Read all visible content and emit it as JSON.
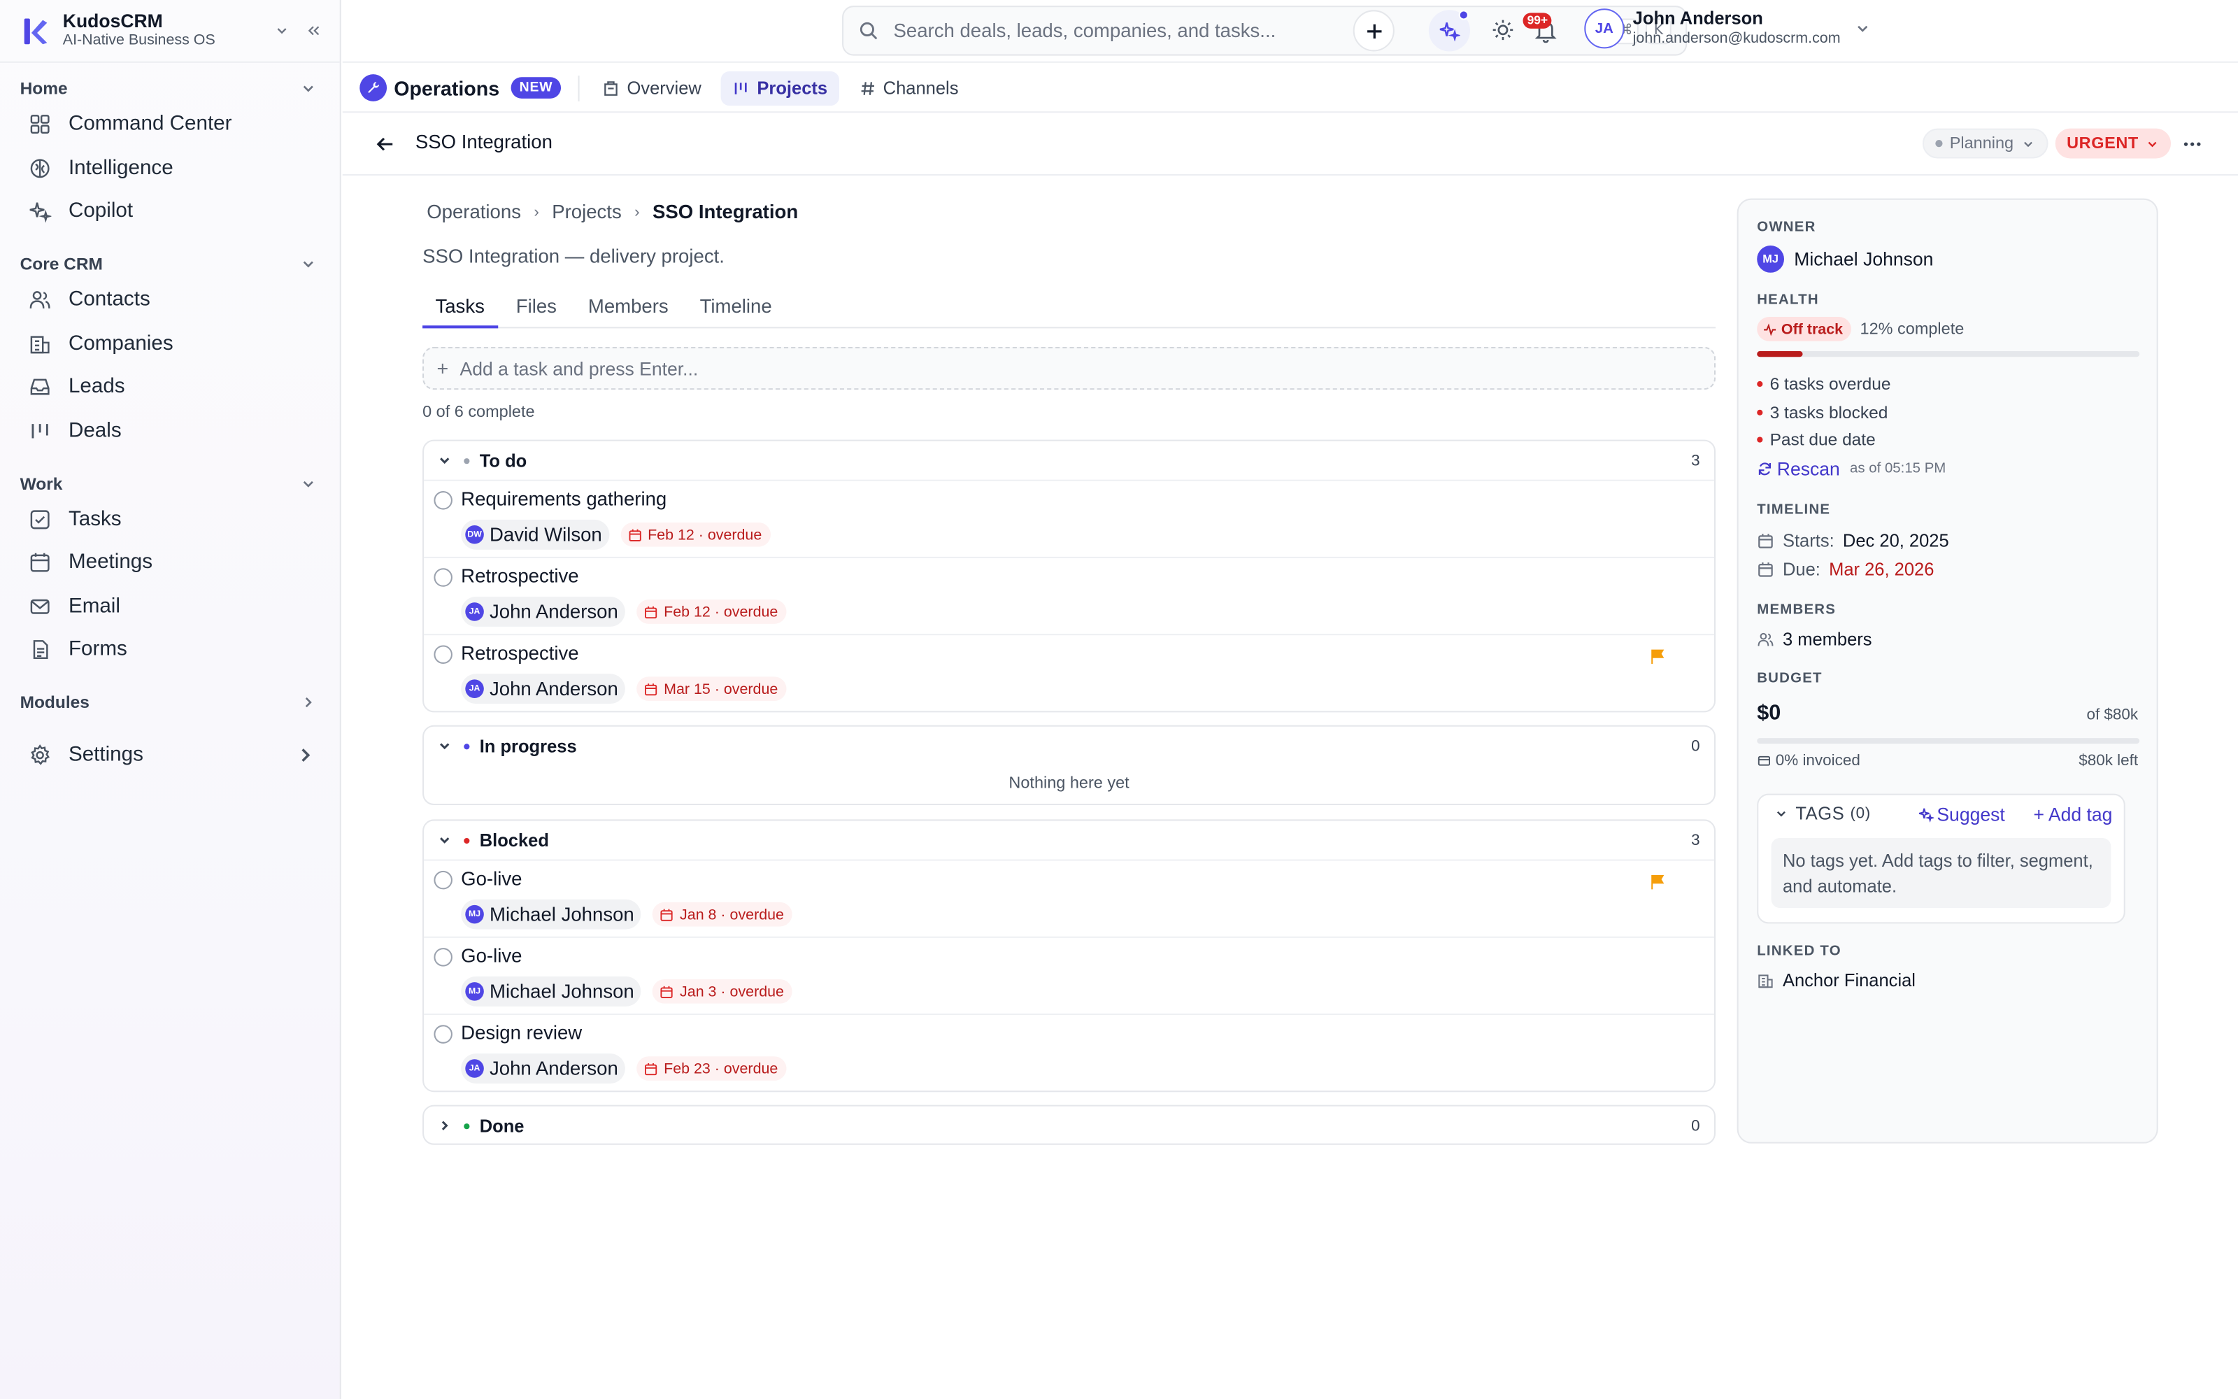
{
  "brand": {
    "name": "KudosCRM",
    "tagline": "AI-Native Business OS"
  },
  "sidebar": {
    "sections": [
      {
        "title": "Home",
        "items": [
          {
            "label": "Command Center",
            "icon": "grid-icon"
          },
          {
            "label": "Intelligence",
            "icon": "brain-icon"
          },
          {
            "label": "Copilot",
            "icon": "sparkle-icon"
          }
        ]
      },
      {
        "title": "Core CRM",
        "items": [
          {
            "label": "Contacts",
            "icon": "users-icon"
          },
          {
            "label": "Companies",
            "icon": "building-icon"
          },
          {
            "label": "Leads",
            "icon": "inbox-icon"
          },
          {
            "label": "Deals",
            "icon": "kanban-icon"
          }
        ]
      },
      {
        "title": "Work",
        "items": [
          {
            "label": "Tasks",
            "icon": "checkbox-icon"
          },
          {
            "label": "Meetings",
            "icon": "calendar-icon"
          },
          {
            "label": "Email",
            "icon": "mail-icon"
          },
          {
            "label": "Forms",
            "icon": "form-icon"
          }
        ]
      }
    ],
    "modules_label": "Modules",
    "settings_label": "Settings"
  },
  "topbar": {
    "search_placeholder": "Search deals, leads, companies, and tasks...",
    "kbd_mod": "⌘",
    "kbd_key": "K",
    "notif_count": "99+",
    "user": {
      "initials": "JA",
      "name": "John Anderson",
      "email": "john.anderson@kudoscrm.com"
    }
  },
  "module": {
    "title": "Operations",
    "badge": "NEW",
    "tabs": [
      {
        "label": "Overview",
        "active": false
      },
      {
        "label": "Projects",
        "active": true
      },
      {
        "label": "Channels",
        "active": false
      }
    ]
  },
  "page": {
    "title": "SSO Integration",
    "status": "Planning",
    "priority": "URGENT",
    "breadcrumb": [
      "Operations",
      "Projects",
      "SSO Integration"
    ],
    "description": "SSO Integration — delivery project.",
    "tabs": [
      "Tasks",
      "Files",
      "Members",
      "Timeline"
    ],
    "add_task_placeholder": "Add a task and press Enter...",
    "progress_text": "0 of 6 complete"
  },
  "groups": [
    {
      "name": "To do",
      "count": "3",
      "color": "#9ca3af",
      "expanded": true,
      "tasks": [
        {
          "title": "Requirements gathering",
          "assignee": "David Wilson",
          "initials": "DW",
          "due": "Feb 12 · overdue",
          "flag": false
        },
        {
          "title": "Retrospective",
          "assignee": "John Anderson",
          "initials": "JA",
          "due": "Feb 12 · overdue",
          "flag": false
        },
        {
          "title": "Retrospective",
          "assignee": "John Anderson",
          "initials": "JA",
          "due": "Mar 15 · overdue",
          "flag": true
        }
      ]
    },
    {
      "name": "In progress",
      "count": "0",
      "color": "#4f46e5",
      "expanded": true,
      "empty_text": "Nothing here yet",
      "tasks": []
    },
    {
      "name": "Blocked",
      "count": "3",
      "color": "#dc2626",
      "expanded": true,
      "tasks": [
        {
          "title": "Go-live",
          "assignee": "Michael Johnson",
          "initials": "MJ",
          "due": "Jan 8 · overdue",
          "flag": true
        },
        {
          "title": "Go-live",
          "assignee": "Michael Johnson",
          "initials": "MJ",
          "due": "Jan 3 · overdue",
          "flag": false
        },
        {
          "title": "Design review",
          "assignee": "John Anderson",
          "initials": "JA",
          "due": "Feb 23 · overdue",
          "flag": false
        }
      ]
    },
    {
      "name": "Done",
      "count": "0",
      "color": "#16a34a",
      "expanded": false,
      "tasks": []
    }
  ],
  "panel": {
    "owner_label": "OWNER",
    "owner": {
      "name": "Michael Johnson",
      "initials": "MJ"
    },
    "health_label": "HEALTH",
    "health_status": "Off track",
    "health_complete": "12% complete",
    "health_progress": 0.12,
    "issues": [
      "6 tasks overdue",
      "3 tasks blocked",
      "Past due date"
    ],
    "rescan_label": "Rescan",
    "rescan_time": "as of 05:15 PM",
    "timeline_label": "TIMELINE",
    "starts_label": "Starts:",
    "starts": "Dec 20, 2025",
    "due_label": "Due:",
    "due": "Mar 26, 2026",
    "members_label": "MEMBERS",
    "members": "3 members",
    "budget_label": "BUDGET",
    "budget_spent": "$0",
    "budget_total": "of $80k",
    "budget_progress": 0,
    "invoiced": "0% invoiced",
    "budget_left": "$80k left",
    "tags_label": "TAGS",
    "tags_count": "(0)",
    "suggest_label": "Suggest",
    "add_tag_label": "+ Add tag",
    "no_tags": "No tags yet. Add tags to filter, segment, and automate.",
    "linked_label": "LINKED TO",
    "linked": "Anchor Financial"
  },
  "colors": {
    "accent": "#4f46e5",
    "danger": "#dc2626",
    "warning": "#f59e0b"
  }
}
